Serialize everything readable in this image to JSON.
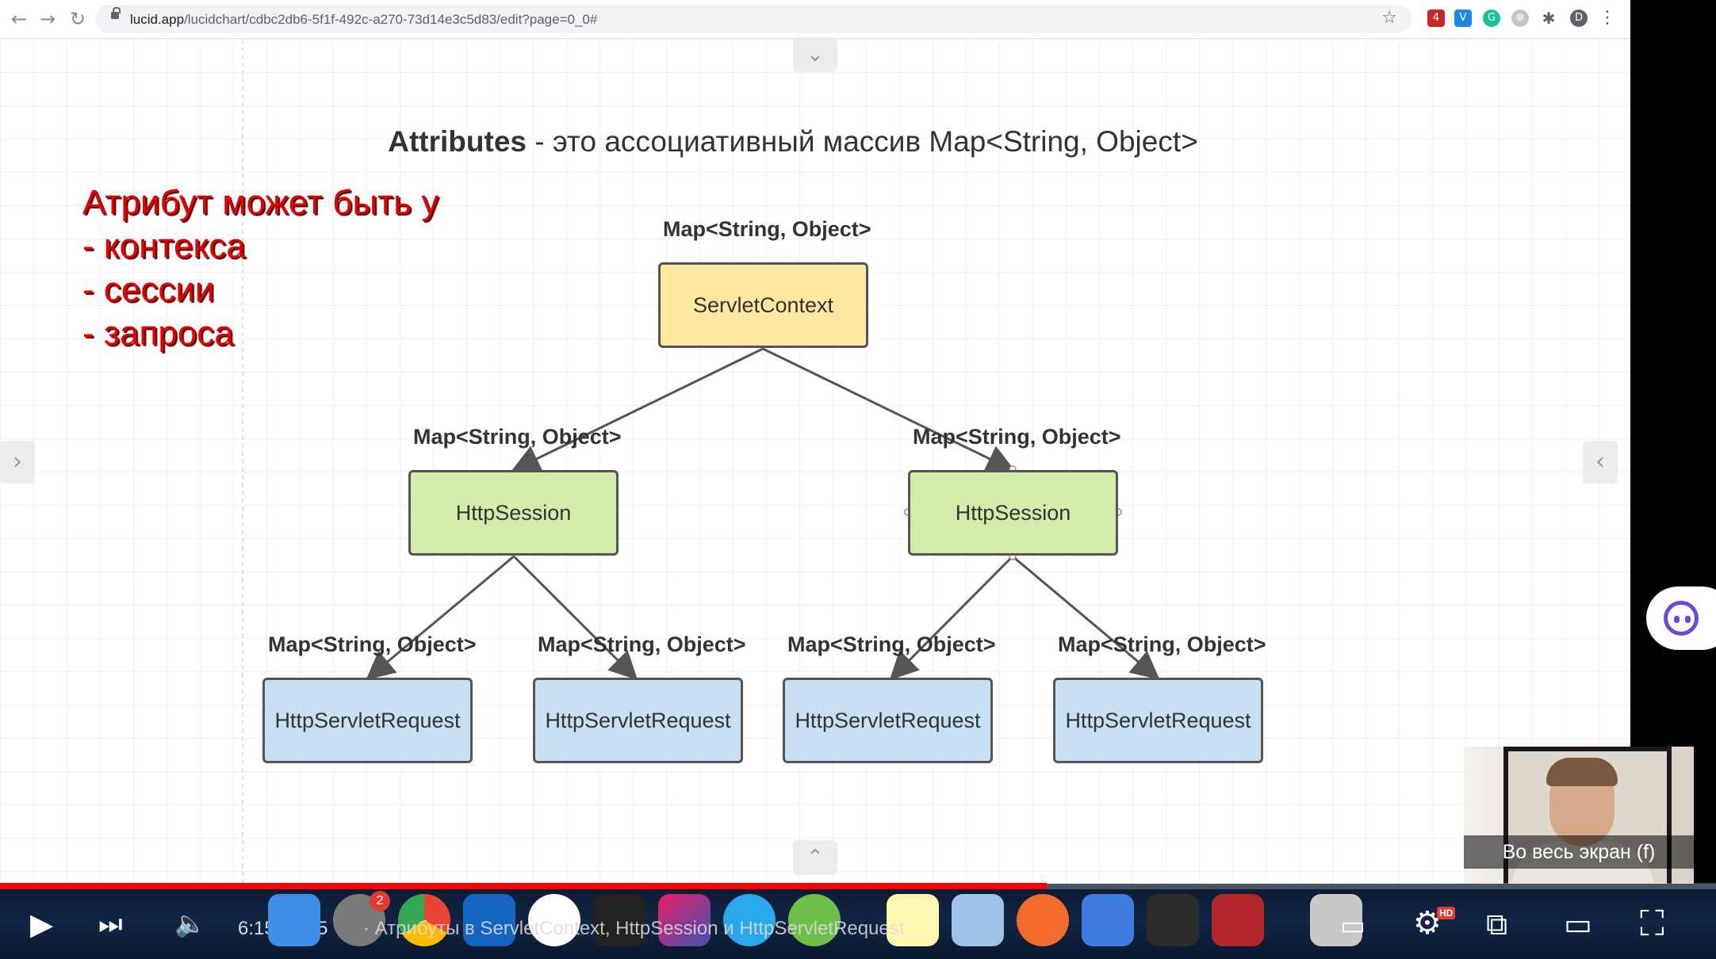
{
  "browser": {
    "url_domain": "lucid.app",
    "url_path": "/lucidchart/cdbc2db6-5f1f-492c-a270-73d14e3c5d83/edit?page=0_0#",
    "profile_initial": "D",
    "extension_badge": "4"
  },
  "slide": {
    "title_bold": "Attributes",
    "title_rest": " - это ассоциативный массив Map<String, Object>",
    "note_lines": [
      "Атрибут может быть у",
      "- контекса",
      "- сессии",
      "- запроса"
    ]
  },
  "diagram": {
    "map_label": "Map<String, Object>",
    "root": "ServletContext",
    "session": "HttpSession",
    "request": "HttpServletRequest"
  },
  "webcam": {
    "overlay_text": "Во весь экран (f)"
  },
  "player": {
    "time": "6:15 / 8:25",
    "video_title": "· Атрибуты в ServletContext, HttpSession и HttpServletRequest",
    "dock_badge": "2",
    "hd_label": "HD",
    "progress": 0.61
  },
  "colors": {
    "root_fill": "#ffe8a0",
    "session_fill": "#d4eca9",
    "request_fill": "#c8e0f4",
    "note_red": "#e40000",
    "progress_red": "#ff0000"
  }
}
